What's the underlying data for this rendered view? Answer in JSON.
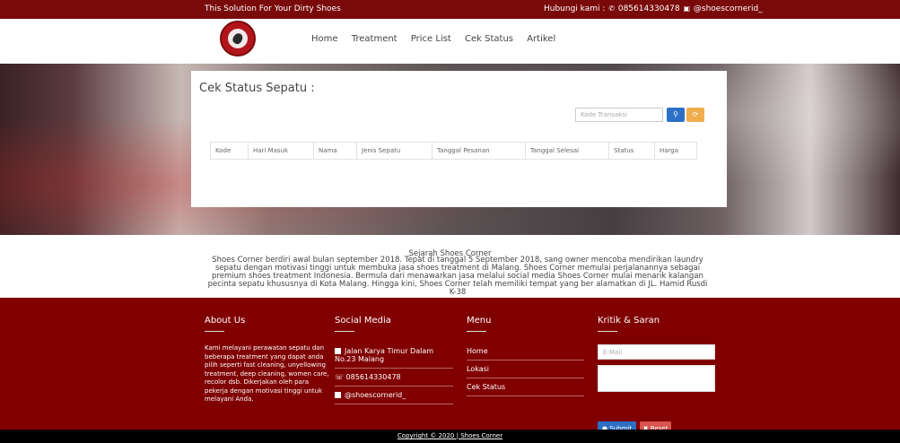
{
  "topbar": {
    "tagline": "This Solution For Your Dirty Shoes",
    "contact_label": "Hubungi kami :",
    "phone": "085614330478",
    "instagram": "@shoescornerid_"
  },
  "nav": {
    "items": [
      "Home",
      "Treatment",
      "Price List",
      "Cek Status",
      "Artikel"
    ]
  },
  "status_card": {
    "title": "Cek Status Sepatu :",
    "search_placeholder": "Kode Transaksi",
    "columns": [
      "Kode",
      "Hari Masuk",
      "Nama",
      "Jenis Sepatu",
      "Tanggal Pesanan",
      "Tanggal Selesai",
      "Status",
      "Harga"
    ]
  },
  "history": {
    "title": "Sejarah Shoes Corner",
    "body": "Shoes Corner berdiri awal bulan september 2018. Tepat di tanggal 5 September 2018, sang owner mencoba mendirikan laundry sepatu dengan motivasi tinggi untuk membuka jasa shoes treatment di Malang. Shoes Corner memulai perjalanannya sebagai premium shoes treatment Indonesia. Bermula dari menawarkan jasa melalui social media Shoes Corner mulai menarik kalangan pecinta sepatu khususnya di Kota Malang. Hingga kini, Shoes Corner telah memiliki tempat yang ber alamatkan di JL. Hamid Rusdi K-38"
  },
  "footer": {
    "about": {
      "title": "About Us",
      "text": "Kami melayani perawatan sepatu dan beberapa treatment yang dapat anda pilih seperti fast cleaning, unyellowing treatment, deep cleaning, women care, recolor dsb. Dikerjakan oleh para pekerja dengan motivasi tinggi untuk melayani Anda."
    },
    "social": {
      "title": "Social Media",
      "address": "Jalan Karya Timur Dalam No.23 Malang",
      "phone": "085614330478",
      "instagram": "@shoescornerid_"
    },
    "menu": {
      "title": "Menu",
      "items": [
        "Home",
        "Lokasi",
        "Cek Status"
      ]
    },
    "feedback": {
      "title": "Kritik & Saran",
      "email_placeholder": "E-Mail",
      "submit_label": "Submit",
      "reset_label": "Reset"
    }
  },
  "copyright": {
    "prefix": "Copyright © 2020 |",
    "brand": "Shoes Corner"
  },
  "colors": {
    "brand_red": "#800000",
    "button_blue": "#2c70c5",
    "button_orange": "#f0ad4e",
    "reset_red": "#d9534f"
  }
}
